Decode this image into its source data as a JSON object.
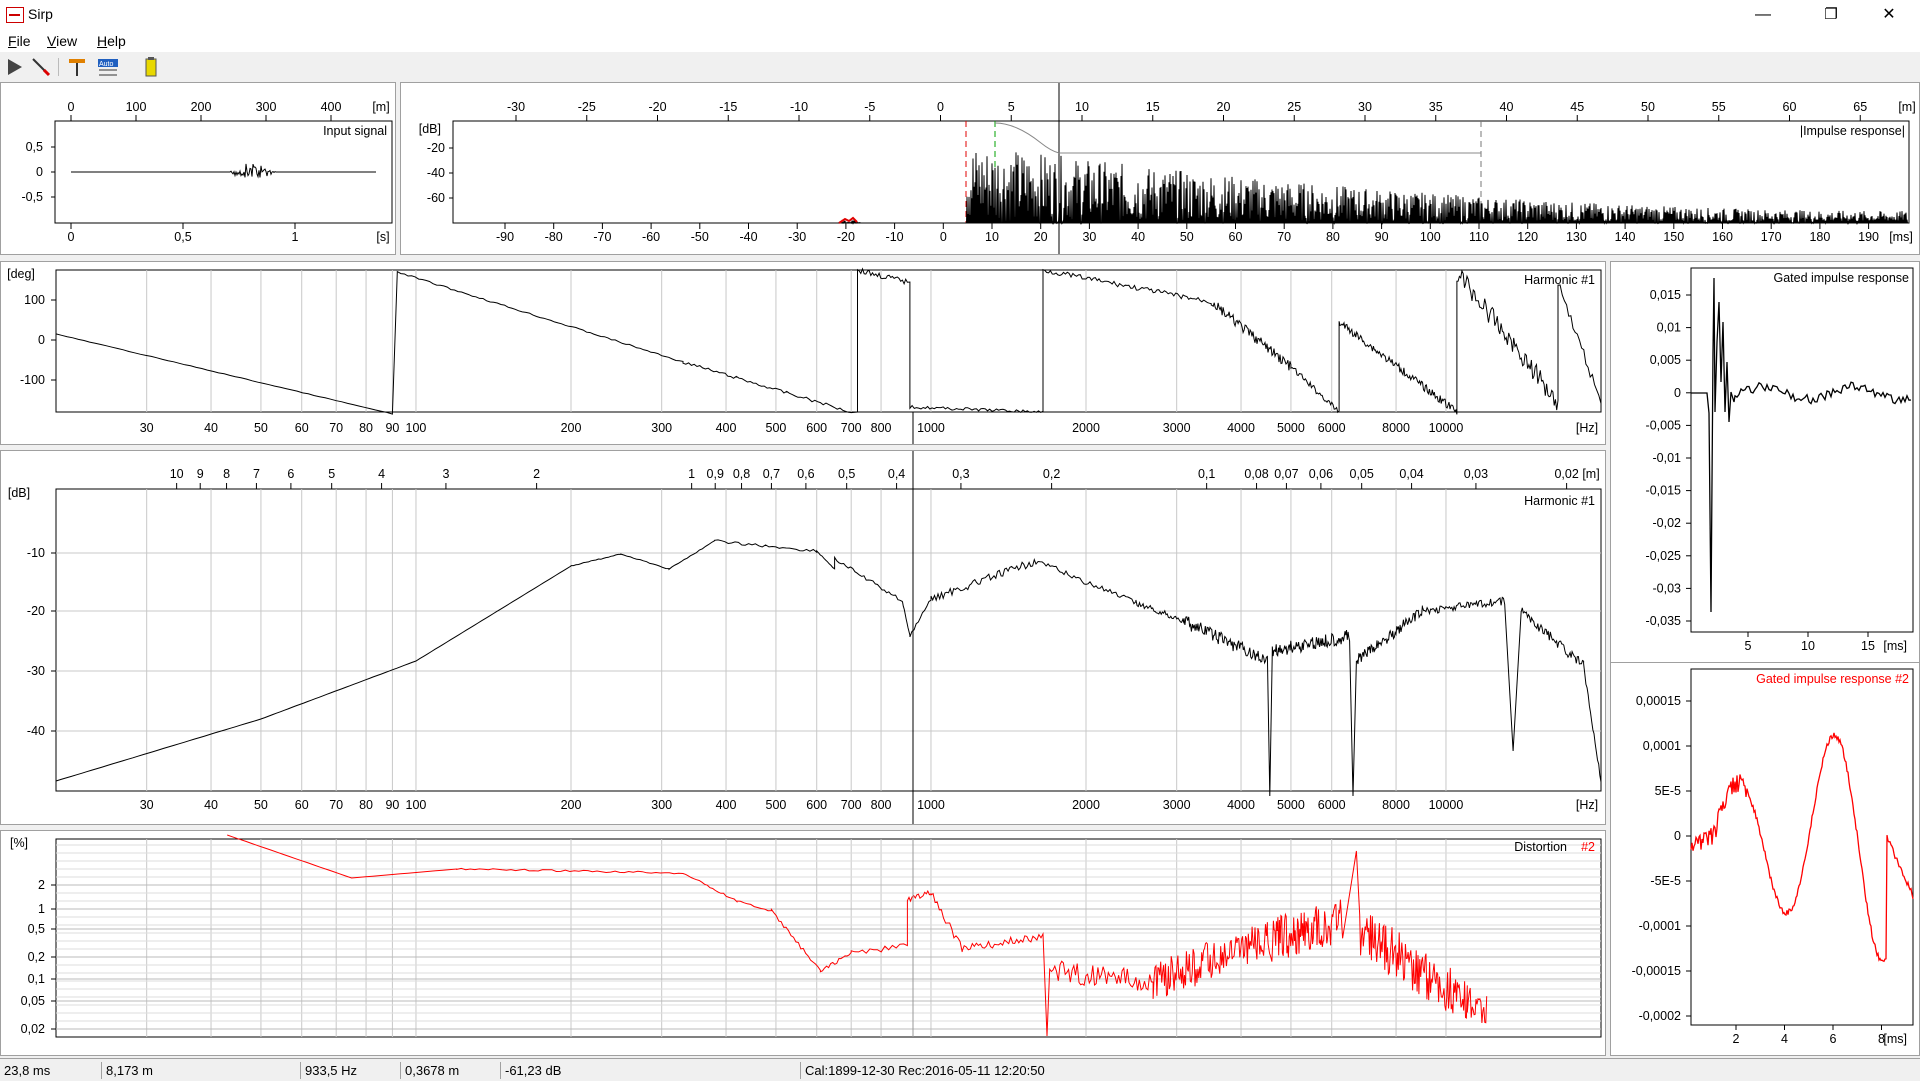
{
  "window": {
    "title": "Sirp",
    "minimize": "—",
    "maximize": "❐",
    "close": "✕"
  },
  "menu": [
    {
      "key": "file",
      "underlined": "F",
      "rest": "ile"
    },
    {
      "key": "view",
      "underlined": "V",
      "rest": "iew"
    },
    {
      "key": "help",
      "underlined": "H",
      "rest": "elp"
    }
  ],
  "toolbar": {
    "auto_label": "Auto",
    "icons": [
      "play-icon",
      "pen-icon",
      "marker-icon",
      "auto-scale-icon",
      "battery-icon"
    ]
  },
  "input_signal": {
    "title": "Input signal",
    "top_axis": {
      "ticks": [
        "0",
        "100",
        "200",
        "300",
        "400"
      ],
      "unit": "[m]"
    },
    "bottom_axis": {
      "ticks": [
        "0",
        "0,5",
        "1"
      ],
      "unit": "[s]"
    },
    "y_ticks": [
      "0,5",
      "0",
      "-0,5"
    ]
  },
  "impulse_response": {
    "title": "|Impulse response|",
    "top_axis": {
      "ticks": [
        "-30",
        "-25",
        "-20",
        "-15",
        "-10",
        "-5",
        "0",
        "5",
        "10",
        "15",
        "20",
        "25",
        "30",
        "35",
        "40",
        "45",
        "50",
        "55",
        "60",
        "65"
      ],
      "unit": "[m]"
    },
    "bottom_axis": {
      "ticks": [
        "-90",
        "-80",
        "-70",
        "-60",
        "-50",
        "-40",
        "-30",
        "-20",
        "-10",
        "0",
        "10",
        "20",
        "30",
        "40",
        "50",
        "60",
        "70",
        "80",
        "90",
        "100",
        "110",
        "120",
        "130",
        "140",
        "150",
        "160",
        "170",
        "180",
        "190"
      ],
      "unit": "[ms]"
    },
    "y_unit": "[dB]",
    "y_ticks": [
      "-20",
      "-40",
      "-60"
    ]
  },
  "phase": {
    "title": "Harmonic #1",
    "y_unit": "[deg]",
    "y_ticks": [
      "100",
      "0",
      "-100"
    ],
    "x_ticks": [
      "30",
      "40",
      "50",
      "60",
      "70",
      "80",
      "90",
      "100",
      "200",
      "300",
      "400",
      "500",
      "600",
      "700",
      "800",
      "1000",
      "2000",
      "3000",
      "4000",
      "5000",
      "6000",
      "8000",
      "10000"
    ],
    "x_unit": "[Hz]"
  },
  "magnitude": {
    "title": "Harmonic #1",
    "y_unit": "[dB]",
    "y_ticks": [
      "-10",
      "-20",
      "-30",
      "-40"
    ],
    "x_ticks": [
      "30",
      "40",
      "50",
      "60",
      "70",
      "80",
      "90",
      "100",
      "200",
      "300",
      "400",
      "500",
      "600",
      "700",
      "800",
      "1000",
      "2000",
      "3000",
      "4000",
      "5000",
      "6000",
      "8000",
      "10000"
    ],
    "x_unit": "[Hz]",
    "top_ticks": [
      "10",
      "9",
      "8",
      "7",
      "6",
      "5",
      "4",
      "3",
      "2",
      "1",
      "0,9",
      "0,8",
      "0,7",
      "0,6",
      "0,5",
      "0,4",
      "0,3",
      "0,2",
      "0,1",
      "0,08",
      "0,07",
      "0,06",
      "0,05",
      "0,04",
      "0,03",
      "0,02"
    ],
    "top_unit": "[m]"
  },
  "distortion": {
    "title": "Distortion",
    "title_suffix": "#2",
    "y_unit": "[%]",
    "y_ticks": [
      "2",
      "1",
      "0,5",
      "0,2",
      "0,1",
      "0,05",
      "0,02"
    ]
  },
  "gated1": {
    "title": "Gated impulse response",
    "y_ticks": [
      "0,015",
      "0,01",
      "0,005",
      "0",
      "-0,005",
      "-0,01",
      "-0,015",
      "-0,02",
      "-0,025",
      "-0,03",
      "-0,035"
    ],
    "x_ticks": [
      "5",
      "10",
      "15"
    ],
    "x_unit": "[ms]"
  },
  "gated2": {
    "title": "Gated impulse response #2",
    "y_ticks": [
      "0,00015",
      "0,0001",
      "5E-5",
      "0",
      "-5E-5",
      "-0,0001",
      "-0,00015",
      "-0,0002"
    ],
    "x_ticks": [
      "2",
      "4",
      "6",
      "8"
    ],
    "x_unit": "[ms]"
  },
  "status": [
    "23,8 ms",
    "8,173 m",
    "933,5 Hz",
    "0,3678 m",
    "-61,23 dB",
    "Cal:1899-12-30 Rec:2016-05-11 12:20:50"
  ],
  "colors": {
    "trace": "#000000",
    "distortion": "#ff0000",
    "grid": "#c8c8c8",
    "gate_green": "#00a000",
    "gate_red": "#e00000",
    "gate_blue": "#0000ff"
  }
}
